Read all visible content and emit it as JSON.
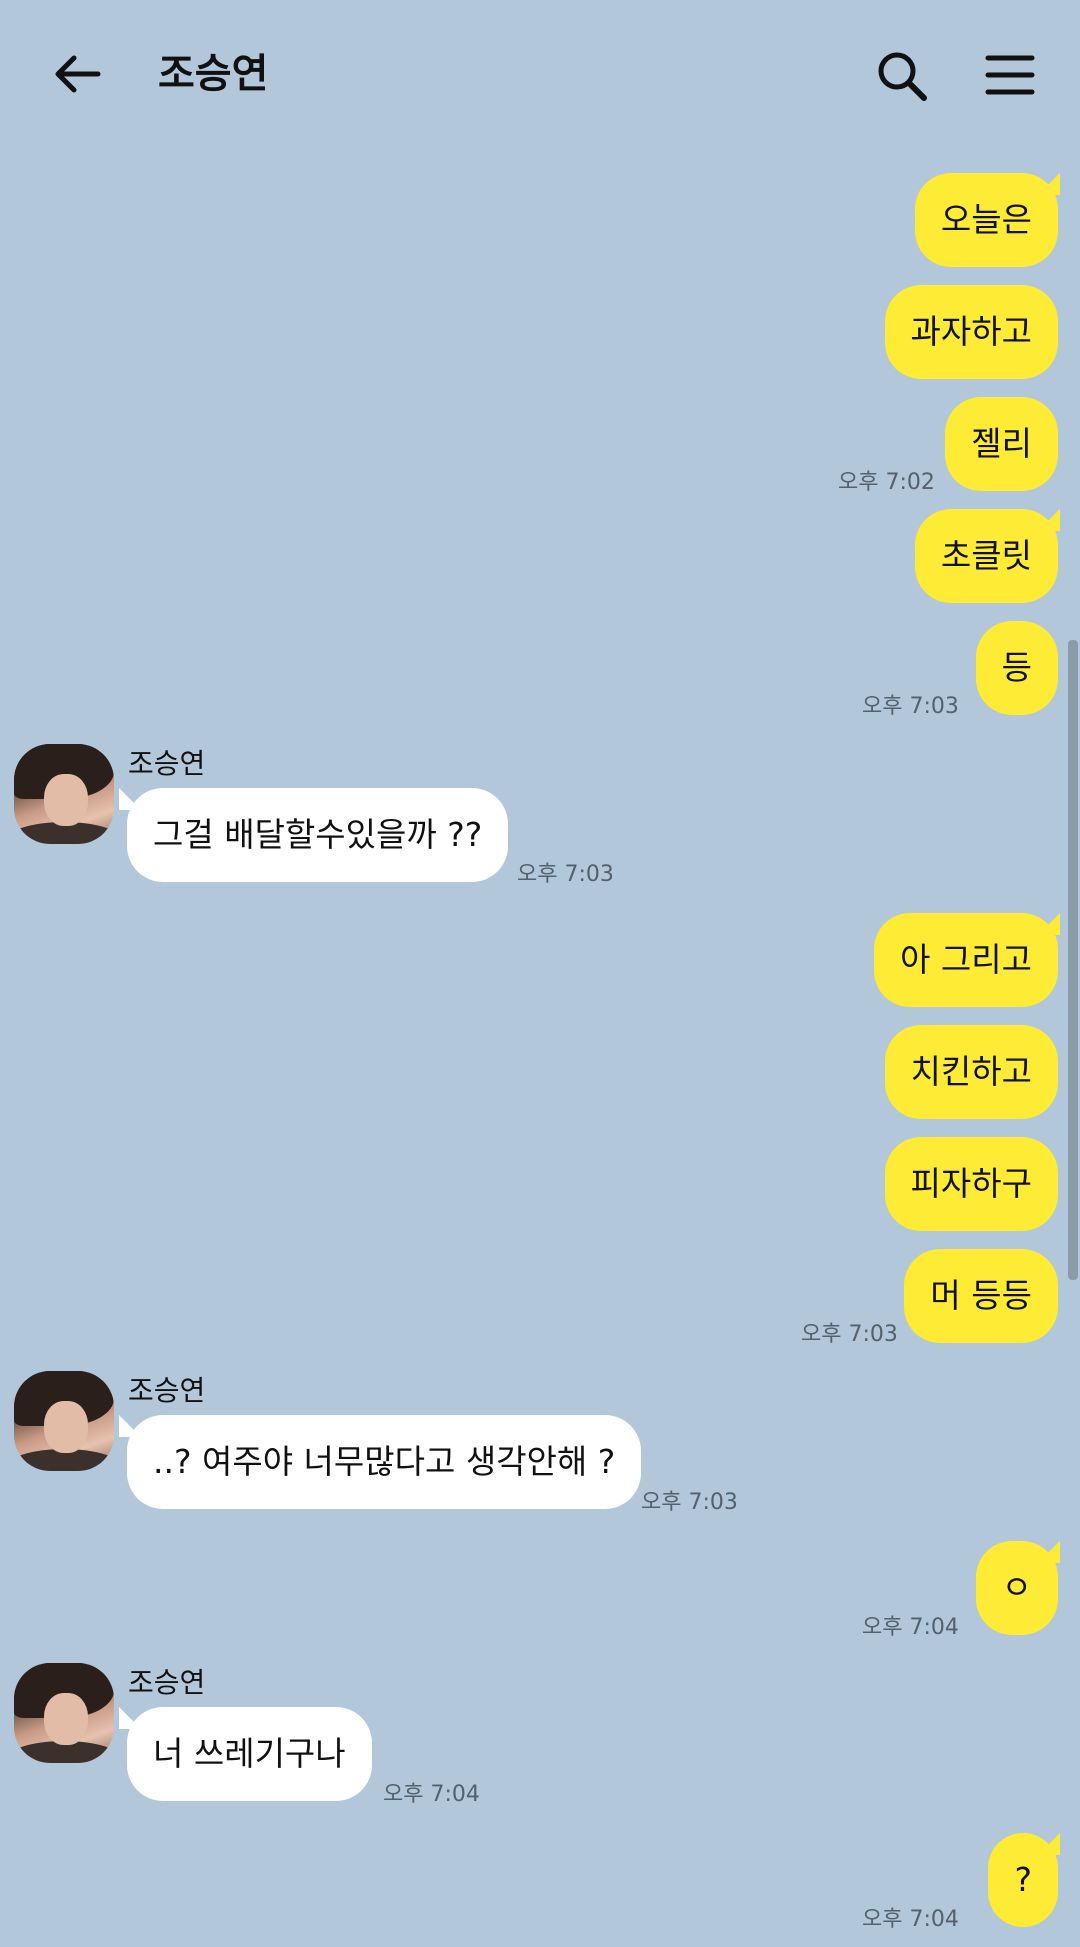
{
  "header": {
    "title": "조승연",
    "back_icon": "arrow-left-icon",
    "search_icon": "search-icon",
    "menu_icon": "hamburger-menu-icon"
  },
  "colors": {
    "background": "#B2C7DA",
    "my_bubble": "#FEEB36",
    "their_bubble": "#FFFFFF",
    "time_text": "#55606A"
  },
  "contact": {
    "name": "조승연"
  },
  "messages": {
    "m1": "오늘은",
    "m2": "과자하고",
    "m3": "젤리",
    "t1": "오후 7:02",
    "m4": "초클릿",
    "m5": "등",
    "t2": "오후 7:03",
    "r1": "그걸 배달할수있을까 ??",
    "t3": "오후 7:03",
    "m6": "아 그리고",
    "m7": "치킨하고",
    "m8": "피자하구",
    "m9": "머 등등",
    "t4": "오후 7:03",
    "r2": "..? 여주야 너무많다고 생각안해 ?",
    "t5": "오후 7:03",
    "m10": "ㅇ",
    "t6": "오후 7:04",
    "r3": "너 쓰레기구나",
    "t7": "오후 7:04",
    "m11": "?",
    "t8": "오후 7:04"
  }
}
